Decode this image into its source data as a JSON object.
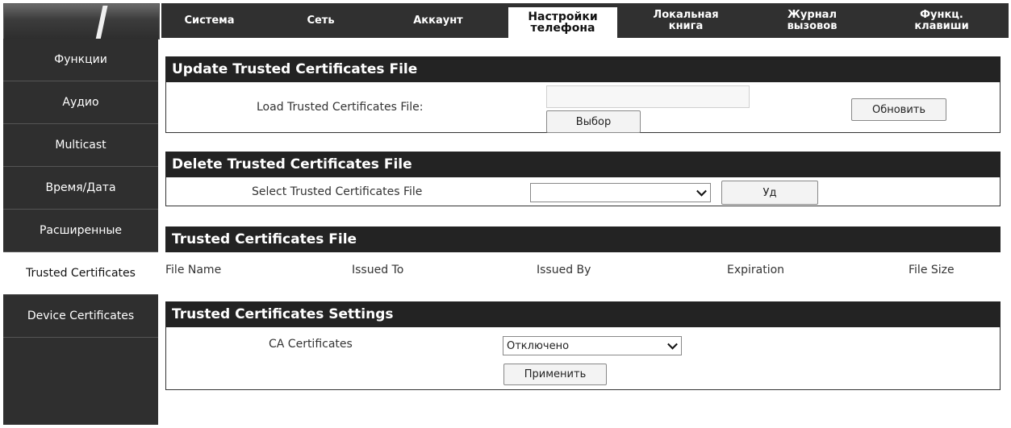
{
  "nav": {
    "tabs": [
      {
        "label": "Система"
      },
      {
        "label": "Сеть"
      },
      {
        "label": "Аккаунт"
      },
      {
        "label": "Настройки\nтелефона"
      },
      {
        "label": "Локальная\nкнига"
      },
      {
        "label": "Журнал\nвызовов"
      },
      {
        "label": "Функц.\nклавиши"
      }
    ],
    "active_tab": "Настройки телефона"
  },
  "sidebar": {
    "items": [
      {
        "label": "Функции"
      },
      {
        "label": "Аудио"
      },
      {
        "label": "Multicast"
      },
      {
        "label": "Время/Дата"
      },
      {
        "label": "Расширенные"
      },
      {
        "label": "Trusted Certificates"
      },
      {
        "label": "Device Certificates"
      }
    ],
    "active_item": "Trusted Certificates"
  },
  "update_section": {
    "title": "Update Trusted Certificates File",
    "load_label": "Load Trusted Certificates File:",
    "file_path_value": "",
    "browse_button": "Выбор",
    "update_button": "Обновить"
  },
  "delete_section": {
    "title": "Delete Trusted Certificates File",
    "select_label": "Select Trusted Certificates File",
    "select_value": "",
    "delete_button": "Уд"
  },
  "files_section": {
    "title": "Trusted Certificates File",
    "columns": [
      "File Name",
      "Issued To",
      "Issued By",
      "Expiration",
      "File Size"
    ],
    "rows": []
  },
  "settings_section": {
    "title": "Trusted Certificates Settings",
    "ca_label": "CA Certificates",
    "ca_value": "Отключено",
    "apply_button": "Применить"
  },
  "colors": {
    "nav_bg": "#303030",
    "section_bar_bg": "#232323",
    "active_bg": "#ffffff"
  }
}
